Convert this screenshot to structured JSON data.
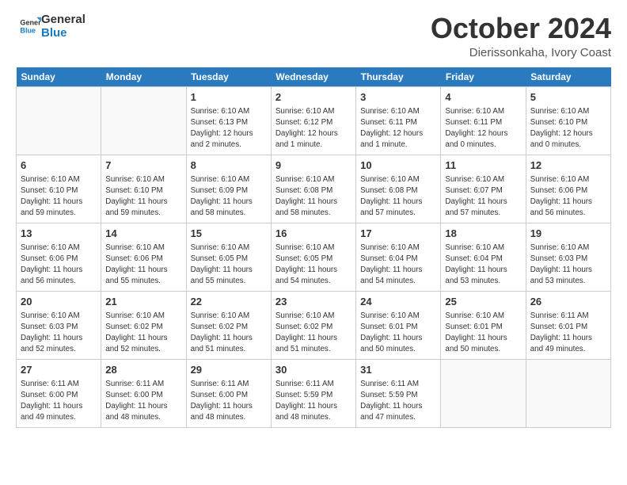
{
  "logo": {
    "line1": "General",
    "line2": "Blue"
  },
  "title": "October 2024",
  "subtitle": "Dierissonkaha, Ivory Coast",
  "headers": [
    "Sunday",
    "Monday",
    "Tuesday",
    "Wednesday",
    "Thursday",
    "Friday",
    "Saturday"
  ],
  "weeks": [
    [
      {
        "day": "",
        "text": ""
      },
      {
        "day": "",
        "text": ""
      },
      {
        "day": "1",
        "text": "Sunrise: 6:10 AM\nSunset: 6:13 PM\nDaylight: 12 hours\nand 2 minutes."
      },
      {
        "day": "2",
        "text": "Sunrise: 6:10 AM\nSunset: 6:12 PM\nDaylight: 12 hours\nand 1 minute."
      },
      {
        "day": "3",
        "text": "Sunrise: 6:10 AM\nSunset: 6:11 PM\nDaylight: 12 hours\nand 1 minute."
      },
      {
        "day": "4",
        "text": "Sunrise: 6:10 AM\nSunset: 6:11 PM\nDaylight: 12 hours\nand 0 minutes."
      },
      {
        "day": "5",
        "text": "Sunrise: 6:10 AM\nSunset: 6:10 PM\nDaylight: 12 hours\nand 0 minutes."
      }
    ],
    [
      {
        "day": "6",
        "text": "Sunrise: 6:10 AM\nSunset: 6:10 PM\nDaylight: 11 hours\nand 59 minutes."
      },
      {
        "day": "7",
        "text": "Sunrise: 6:10 AM\nSunset: 6:10 PM\nDaylight: 11 hours\nand 59 minutes."
      },
      {
        "day": "8",
        "text": "Sunrise: 6:10 AM\nSunset: 6:09 PM\nDaylight: 11 hours\nand 58 minutes."
      },
      {
        "day": "9",
        "text": "Sunrise: 6:10 AM\nSunset: 6:08 PM\nDaylight: 11 hours\nand 58 minutes."
      },
      {
        "day": "10",
        "text": "Sunrise: 6:10 AM\nSunset: 6:08 PM\nDaylight: 11 hours\nand 57 minutes."
      },
      {
        "day": "11",
        "text": "Sunrise: 6:10 AM\nSunset: 6:07 PM\nDaylight: 11 hours\nand 57 minutes."
      },
      {
        "day": "12",
        "text": "Sunrise: 6:10 AM\nSunset: 6:06 PM\nDaylight: 11 hours\nand 56 minutes."
      }
    ],
    [
      {
        "day": "13",
        "text": "Sunrise: 6:10 AM\nSunset: 6:06 PM\nDaylight: 11 hours\nand 56 minutes."
      },
      {
        "day": "14",
        "text": "Sunrise: 6:10 AM\nSunset: 6:06 PM\nDaylight: 11 hours\nand 55 minutes."
      },
      {
        "day": "15",
        "text": "Sunrise: 6:10 AM\nSunset: 6:05 PM\nDaylight: 11 hours\nand 55 minutes."
      },
      {
        "day": "16",
        "text": "Sunrise: 6:10 AM\nSunset: 6:05 PM\nDaylight: 11 hours\nand 54 minutes."
      },
      {
        "day": "17",
        "text": "Sunrise: 6:10 AM\nSunset: 6:04 PM\nDaylight: 11 hours\nand 54 minutes."
      },
      {
        "day": "18",
        "text": "Sunrise: 6:10 AM\nSunset: 6:04 PM\nDaylight: 11 hours\nand 53 minutes."
      },
      {
        "day": "19",
        "text": "Sunrise: 6:10 AM\nSunset: 6:03 PM\nDaylight: 11 hours\nand 53 minutes."
      }
    ],
    [
      {
        "day": "20",
        "text": "Sunrise: 6:10 AM\nSunset: 6:03 PM\nDaylight: 11 hours\nand 52 minutes."
      },
      {
        "day": "21",
        "text": "Sunrise: 6:10 AM\nSunset: 6:02 PM\nDaylight: 11 hours\nand 52 minutes."
      },
      {
        "day": "22",
        "text": "Sunrise: 6:10 AM\nSunset: 6:02 PM\nDaylight: 11 hours\nand 51 minutes."
      },
      {
        "day": "23",
        "text": "Sunrise: 6:10 AM\nSunset: 6:02 PM\nDaylight: 11 hours\nand 51 minutes."
      },
      {
        "day": "24",
        "text": "Sunrise: 6:10 AM\nSunset: 6:01 PM\nDaylight: 11 hours\nand 50 minutes."
      },
      {
        "day": "25",
        "text": "Sunrise: 6:10 AM\nSunset: 6:01 PM\nDaylight: 11 hours\nand 50 minutes."
      },
      {
        "day": "26",
        "text": "Sunrise: 6:11 AM\nSunset: 6:01 PM\nDaylight: 11 hours\nand 49 minutes."
      }
    ],
    [
      {
        "day": "27",
        "text": "Sunrise: 6:11 AM\nSunset: 6:00 PM\nDaylight: 11 hours\nand 49 minutes."
      },
      {
        "day": "28",
        "text": "Sunrise: 6:11 AM\nSunset: 6:00 PM\nDaylight: 11 hours\nand 48 minutes."
      },
      {
        "day": "29",
        "text": "Sunrise: 6:11 AM\nSunset: 6:00 PM\nDaylight: 11 hours\nand 48 minutes."
      },
      {
        "day": "30",
        "text": "Sunrise: 6:11 AM\nSunset: 5:59 PM\nDaylight: 11 hours\nand 48 minutes."
      },
      {
        "day": "31",
        "text": "Sunrise: 6:11 AM\nSunset: 5:59 PM\nDaylight: 11 hours\nand 47 minutes."
      },
      {
        "day": "",
        "text": ""
      },
      {
        "day": "",
        "text": ""
      }
    ]
  ]
}
